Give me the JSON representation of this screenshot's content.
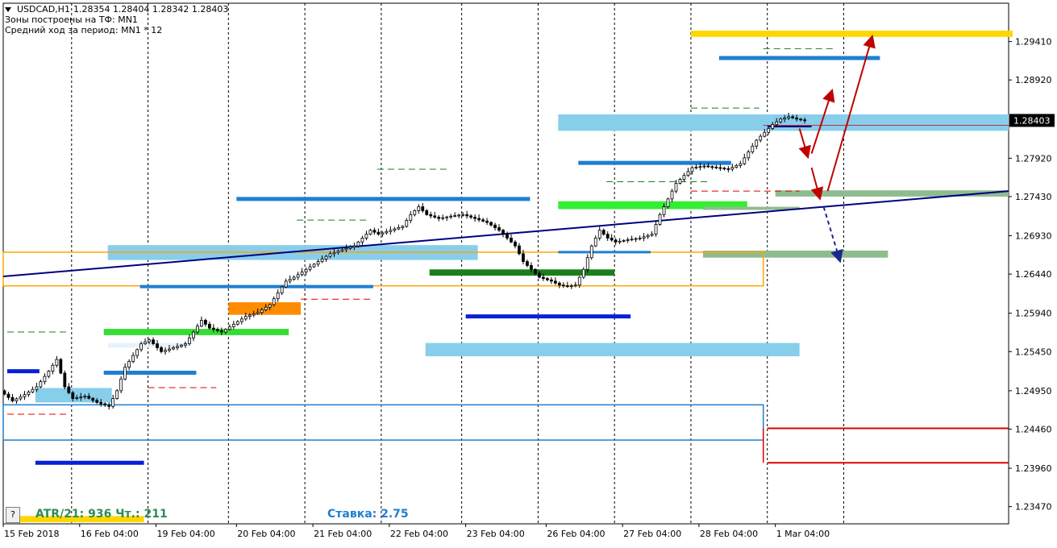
{
  "header": {
    "symbol": "USDCAD,H1",
    "ohlc": "1.28354 1.28404 1.28342 1.28403",
    "line2": "Зоны построены на ТФ: MN1",
    "line3": "Средний ход за период: MN1 * 12"
  },
  "footer": {
    "help_label": "?",
    "atr": "ATR/21: 936  Чт.: 211",
    "rate": "Ставка: 2.75"
  },
  "colors": {
    "atr": "#2e8b57",
    "rate": "#1e7fd0",
    "price_marker_bg": "#000000"
  },
  "chart_data": {
    "type": "candlestick",
    "title": "USDCAD,H1",
    "y_ticks": [
      "1.29410",
      "1.28920",
      "1.28403",
      "1.27920",
      "1.27430",
      "1.26930",
      "1.26440",
      "1.25940",
      "1.25450",
      "1.24950",
      "1.24460",
      "1.23960",
      "1.23470"
    ],
    "ylim": [
      1.2325,
      1.299
    ],
    "current_price": "1.28403",
    "x_labels": [
      "15 Feb 2018",
      "16 Feb 04:00",
      "19 Feb 04:00",
      "20 Feb 04:00",
      "21 Feb 04:00",
      "22 Feb 04:00",
      "23 Feb 04:00",
      "26 Feb 04:00",
      "27 Feb 04:00",
      "28 Feb 04:00",
      "1 Mar 04:00"
    ],
    "price_path": [
      [
        0,
        1.2495
      ],
      [
        3,
        1.2482
      ],
      [
        6,
        1.249
      ],
      [
        9,
        1.25
      ],
      [
        12,
        1.252
      ],
      [
        14,
        1.2535
      ],
      [
        16,
        1.25
      ],
      [
        18,
        1.2485
      ],
      [
        21,
        1.2488
      ],
      [
        24,
        1.248
      ],
      [
        27,
        1.2475
      ],
      [
        29,
        1.2495
      ],
      [
        31,
        1.2525
      ],
      [
        33,
        1.254
      ],
      [
        35,
        1.2555
      ],
      [
        37,
        1.256
      ],
      [
        40,
        1.2545
      ],
      [
        43,
        1.255
      ],
      [
        46,
        1.2555
      ],
      [
        48,
        1.257
      ],
      [
        50,
        1.2585
      ],
      [
        52,
        1.2575
      ],
      [
        55,
        1.257
      ],
      [
        58,
        1.258
      ],
      [
        61,
        1.259
      ],
      [
        64,
        1.2595
      ],
      [
        67,
        1.2605
      ],
      [
        69,
        1.262
      ],
      [
        71,
        1.2635
      ],
      [
        73,
        1.264
      ],
      [
        76,
        1.265
      ],
      [
        79,
        1.266
      ],
      [
        82,
        1.267
      ],
      [
        85,
        1.2675
      ],
      [
        88,
        1.268
      ],
      [
        90,
        1.269
      ],
      [
        92,
        1.27
      ],
      [
        94,
        1.2695
      ],
      [
        97,
        1.27
      ],
      [
        100,
        1.2705
      ],
      [
        102,
        1.272
      ],
      [
        104,
        1.273
      ],
      [
        106,
        1.272
      ],
      [
        109,
        1.2715
      ],
      [
        112,
        1.2718
      ],
      [
        115,
        1.272
      ],
      [
        118,
        1.2715
      ],
      [
        121,
        1.271
      ],
      [
        124,
        1.27
      ],
      [
        126,
        1.269
      ],
      [
        128,
        1.268
      ],
      [
        130,
        1.266
      ],
      [
        132,
        1.265
      ],
      [
        134,
        1.264
      ],
      [
        137,
        1.2635
      ],
      [
        139,
        1.263
      ],
      [
        141,
        1.2628
      ],
      [
        143,
        1.263
      ],
      [
        145,
        1.265
      ],
      [
        147,
        1.268
      ],
      [
        149,
        1.27
      ],
      [
        151,
        1.269
      ],
      [
        153,
        1.2685
      ],
      [
        156,
        1.2688
      ],
      [
        159,
        1.269
      ],
      [
        162,
        1.2695
      ],
      [
        164,
        1.272
      ],
      [
        166,
        1.274
      ],
      [
        168,
        1.276
      ],
      [
        170,
        1.277
      ],
      [
        172,
        1.278
      ],
      [
        175,
        1.2782
      ],
      [
        178,
        1.278
      ],
      [
        181,
        1.2778
      ],
      [
        184,
        1.2785
      ],
      [
        186,
        1.28
      ],
      [
        188,
        1.2815
      ],
      [
        190,
        1.2825
      ],
      [
        192,
        1.2835
      ],
      [
        194,
        1.2842
      ],
      [
        196,
        1.2845
      ],
      [
        198,
        1.2842
      ],
      [
        200,
        1.284
      ]
    ],
    "time_index_range": [
      0,
      224
    ],
    "label_indices": [
      0,
      19,
      38,
      58,
      77,
      96,
      115,
      135,
      154,
      173,
      192
    ]
  },
  "overlays": {
    "rect_zones": [
      {
        "t0": 8,
        "t1": 27,
        "p0": 1.24985,
        "p1": 1.248,
        "color": "#87ceeb"
      },
      {
        "t0": 26,
        "t1": 46,
        "p0": 1.2556,
        "p1": 1.255,
        "color": "#e6f3ff"
      },
      {
        "t0": 26,
        "t1": 118,
        "p0": 1.2681,
        "p1": 1.2662,
        "color": "#87ceeb"
      },
      {
        "t0": 105,
        "t1": 198,
        "p0": 1.2556,
        "p1": 1.2539,
        "color": "#87ceeb"
      },
      {
        "t0": 138,
        "t1": 250,
        "p0": 1.2848,
        "p1": 1.2827,
        "color": "#87ceeb"
      },
      {
        "t0": 56,
        "t1": 74,
        "p0": 1.2608,
        "p1": 1.2592,
        "color": "#ff8c00"
      },
      {
        "t0": 171,
        "t1": 251,
        "p0": 1.2955,
        "p1": 1.2947,
        "color": "#ffd700"
      },
      {
        "t0": 1,
        "t1": 35,
        "p0": 1.2335,
        "p1": 1.2327,
        "color": "#ffd700"
      },
      {
        "t0": 25,
        "t1": 71,
        "p0": 1.2574,
        "p1": 1.2566,
        "color": "#33dd33"
      },
      {
        "t0": 138,
        "t1": 185,
        "p0": 1.2737,
        "p1": 1.2727,
        "color": "#33ee33"
      },
      {
        "t0": 106,
        "t1": 152,
        "p0": 1.265,
        "p1": 1.2642,
        "color": "#1a7f1a"
      },
      {
        "t0": 192,
        "t1": 250,
        "p0": 1.2751,
        "p1": 1.2743,
        "color": "#8fbc8f"
      },
      {
        "t0": 174,
        "t1": 220,
        "p0": 1.2674,
        "p1": 1.2665,
        "color": "#8fbc8f"
      },
      {
        "t0": 174,
        "t1": 198,
        "p0": 1.273,
        "p1": 1.2726,
        "color": "#8fbc8f"
      }
    ],
    "hlines": [
      {
        "t0": 178,
        "t1": 218,
        "p": 1.292,
        "color": "#1e7fd0",
        "w": 5
      },
      {
        "t0": 143,
        "t1": 181,
        "p": 1.2786,
        "color": "#1e7fd0",
        "w": 5
      },
      {
        "t0": 58,
        "t1": 131,
        "p": 1.274,
        "color": "#1e7fd0",
        "w": 5
      },
      {
        "t0": 25,
        "t1": 48,
        "p": 1.2518,
        "color": "#1e7fd0",
        "w": 5
      },
      {
        "t0": 34,
        "t1": 92,
        "p": 1.2628,
        "color": "#1e7fd0",
        "w": 4
      },
      {
        "t0": 138,
        "t1": 161,
        "p": 1.2672,
        "color": "#1e7fd0",
        "w": 3
      },
      {
        "t0": 115,
        "t1": 156,
        "p": 1.259,
        "color": "#0a1fd8",
        "w": 5
      },
      {
        "t0": 8,
        "t1": 35,
        "p": 1.2403,
        "color": "#0a1fd8",
        "w": 5
      },
      {
        "t0": 1,
        "t1": 9,
        "p": 1.252,
        "color": "#0a1fd8",
        "w": 5
      },
      {
        "t0": 190,
        "t1": 201,
        "p": 1.2833,
        "color": "#000080",
        "w": 3
      },
      {
        "t0": 189,
        "t1": 251,
        "p": 1.2834,
        "color": "#c0303c",
        "w": 1
      },
      {
        "t0": 190,
        "t1": 250,
        "p": 1.2447,
        "color": "#e00000",
        "w": 2
      },
      {
        "t0": 190,
        "t1": 250,
        "p": 1.2403,
        "color": "#e00000",
        "w": 2
      }
    ],
    "dashed_lines": [
      {
        "t0": 189,
        "t1": 207,
        "p": 1.2932,
        "color": "#1a7f1a"
      },
      {
        "t0": 171,
        "t1": 188,
        "p": 1.2856,
        "color": "#1a7f1a"
      },
      {
        "t0": 150,
        "t1": 175,
        "p": 1.2762,
        "color": "#1a7f1a"
      },
      {
        "t0": 93,
        "t1": 111,
        "p": 1.2778,
        "color": "#1a7f1a"
      },
      {
        "t0": 73,
        "t1": 91,
        "p": 1.2713,
        "color": "#1a7f1a"
      },
      {
        "t0": 1,
        "t1": 16,
        "p": 1.257,
        "color": "#1a7f1a"
      },
      {
        "t0": 171,
        "t1": 198,
        "p": 1.275,
        "color": "#e00000"
      },
      {
        "t0": 74,
        "t1": 92,
        "p": 1.2612,
        "color": "#e00000"
      },
      {
        "t0": 36,
        "t1": 53,
        "p": 1.2499,
        "color": "#e00000"
      },
      {
        "t0": 1,
        "t1": 16,
        "p": 1.2465,
        "color": "#e00000"
      }
    ],
    "trend_lines": [
      {
        "t0": 0,
        "p0": 1.2641,
        "t1": 250,
        "p1": 1.275,
        "color": "#000080",
        "w": 2
      }
    ],
    "outline_rects": [
      {
        "t0": 0,
        "t1": 189,
        "p0": 1.2672,
        "p1": 1.2629,
        "color": "#ffa500"
      },
      {
        "t0": 0,
        "t1": 189,
        "p0": 1.2477,
        "p1": 1.2432,
        "color": "#1e7fd0"
      }
    ],
    "arrows": [
      {
        "t0": 198,
        "p0": 1.283,
        "t1": 200,
        "p1": 1.2795,
        "color": "#c00000",
        "dashed": false
      },
      {
        "t0": 201,
        "p0": 1.2798,
        "t1": 206,
        "p1": 1.2877,
        "color": "#c00000",
        "dashed": false
      },
      {
        "t0": 201,
        "p0": 1.278,
        "t1": 203,
        "p1": 1.2742,
        "color": "#c00000",
        "dashed": false
      },
      {
        "t0": 205,
        "p0": 1.275,
        "t1": 216,
        "p1": 1.2946,
        "color": "#c00000",
        "dashed": false
      },
      {
        "t0": 204,
        "p0": 1.273,
        "t1": 208,
        "p1": 1.2662,
        "color": "#1a2a8a",
        "dashed": true
      }
    ],
    "time_grid_indices": [
      17,
      36,
      56,
      75,
      94,
      114,
      133,
      152,
      171,
      190,
      209
    ]
  }
}
